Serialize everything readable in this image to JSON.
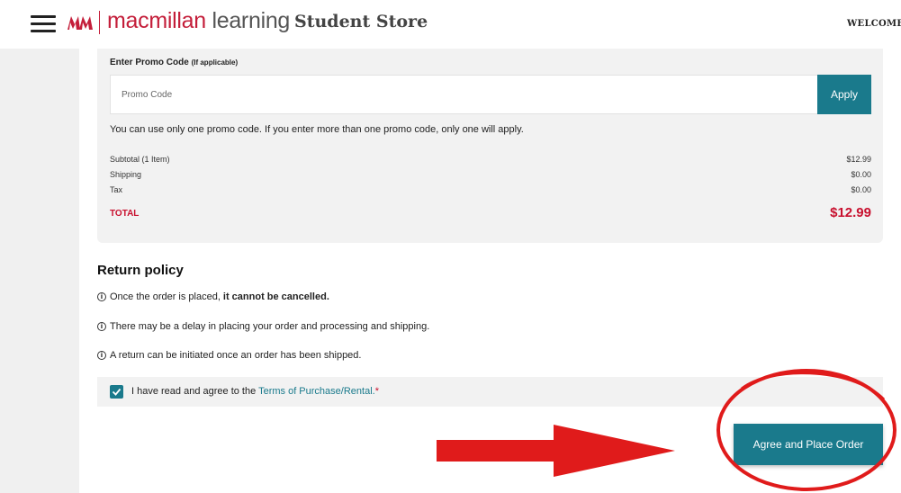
{
  "header": {
    "brand_primary": "macmillan",
    "brand_secondary": " learning",
    "store_title": "Student Store",
    "welcome": "WELCOME V"
  },
  "promo": {
    "label": "Enter Promo Code",
    "label_hint": "(If applicable)",
    "placeholder": "Promo Code",
    "apply_label": "Apply",
    "note": "You can use only one promo code. If you enter more than one promo code, only one will apply."
  },
  "totals": {
    "subtotal_label": "Subtotal (1 Item)",
    "subtotal_value": "$12.99",
    "shipping_label": "Shipping",
    "shipping_value": "$0.00",
    "tax_label": "Tax",
    "tax_value": "$0.00",
    "total_label": "TOTAL",
    "total_value": "$12.99"
  },
  "return_policy": {
    "title": "Return policy",
    "line1_prefix": "Once the order is placed,",
    "line1_bold": "it cannot be cancelled.",
    "line2": "There may be a delay in placing your order and processing and shipping.",
    "line3": "A return can be initiated once an order has been shipped.",
    "info_icon": "i"
  },
  "agreement": {
    "prefix": "I have read and agree to the ",
    "link": "Terms of Purchase/Rental.",
    "required_mark": "*",
    "checked": true
  },
  "place_order": {
    "label": "Agree and Place Order"
  },
  "colors": {
    "teal": "#1a7a8c",
    "brand_red": "#c41e3a",
    "total_red": "#c8102e",
    "annotation_red": "#e01b1b"
  }
}
